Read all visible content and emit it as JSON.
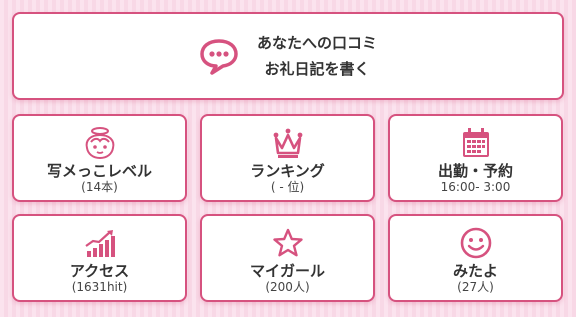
{
  "accent_color": "#d6527f",
  "review": {
    "line1": "あなたへの口コミ",
    "line2": "お礼日記を書く",
    "icon": "speech-bubble-icon"
  },
  "tiles": [
    {
      "label": "写メっこレベル",
      "sub": "(14本)",
      "icon": "angel-face-icon"
    },
    {
      "label": "ランキング",
      "sub": "( - 位)",
      "icon": "crown-icon"
    },
    {
      "label": "出勤・予約",
      "sub": "16:00- 3:00",
      "icon": "calendar-icon"
    },
    {
      "label": "アクセス",
      "sub": "(1631hit)",
      "icon": "growth-chart-icon"
    },
    {
      "label": "マイガール",
      "sub": "(200人)",
      "icon": "star-icon"
    },
    {
      "label": "みたよ",
      "sub": "(27人)",
      "icon": "smiley-icon"
    }
  ]
}
